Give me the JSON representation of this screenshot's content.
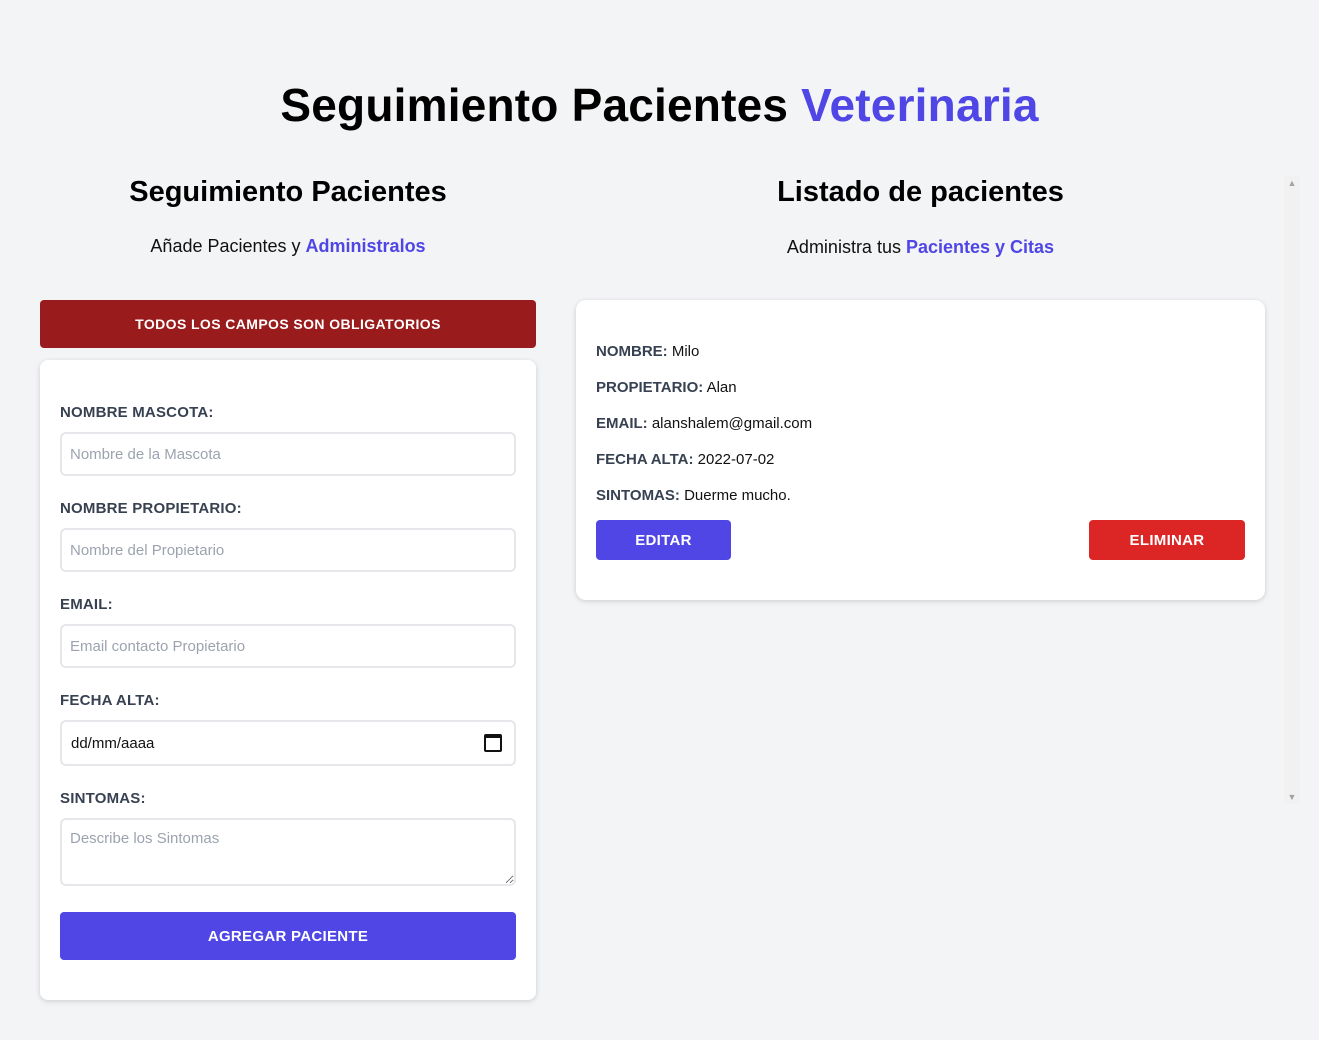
{
  "header": {
    "title_main": "Seguimiento Pacientes",
    "title_accent": "Veterinaria",
    "accent_color": "#4f46e5"
  },
  "form_section": {
    "heading": "Seguimiento Pacientes",
    "subtitle_text": "Añade Pacientes y",
    "subtitle_link": "Administralos",
    "error_message": "TODOS LOS CAMPOS SON OBLIGATORIOS",
    "error_color": "#991b1b",
    "fields": {
      "pet_name": {
        "label": "NOMBRE MASCOTA:",
        "placeholder": "Nombre de la Mascota",
        "value": ""
      },
      "owner_name": {
        "label": "NOMBRE PROPIETARIO:",
        "placeholder": "Nombre del Propietario",
        "value": ""
      },
      "email": {
        "label": "EMAIL:",
        "placeholder": "Email contacto Propietario",
        "value": ""
      },
      "date": {
        "label": "FECHA ALTA:",
        "value": "dd/mm/aaaa"
      },
      "symptoms": {
        "label": "SINTOMAS:",
        "placeholder": "Describe los Sintomas",
        "value": ""
      }
    },
    "submit_label": "AGREGAR PACIENTE"
  },
  "list_section": {
    "heading": "Listado de pacientes",
    "subtitle_text": "Administra tus",
    "subtitle_link": "Pacientes y Citas",
    "patients": [
      {
        "name_label": "NOMBRE:",
        "name": "Milo",
        "owner_label": "PROPIETARIO:",
        "owner": "Alan",
        "email_label": "EMAIL:",
        "email": "alanshalem@gmail.com",
        "date_label": "FECHA ALTA:",
        "date": "2022-07-02",
        "symptoms_label": "SINTOMAS:",
        "symptoms": "Duerme mucho.",
        "edit_label": "EDITAR",
        "delete_label": "ELIMINAR"
      }
    ]
  },
  "scrollbar": {
    "up_icon": "chevron-up-icon",
    "down_icon": "chevron-down-icon"
  }
}
